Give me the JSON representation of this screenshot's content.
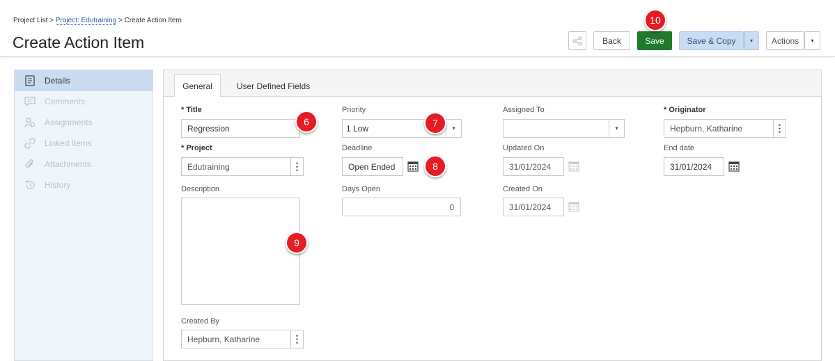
{
  "breadcrumb": {
    "root": "Project List",
    "sep1": ">",
    "project": "Project: Edutraining",
    "sep2": ">",
    "current": "Create Action Item"
  },
  "page_title": "Create Action Item",
  "toolbar": {
    "back_label": "Back",
    "save_label": "Save",
    "save_copy_label": "Save & Copy",
    "actions_label": "Actions",
    "caret": "▾"
  },
  "markers": {
    "m6": "6",
    "m7": "7",
    "m8": "8",
    "m9": "9",
    "m10": "10"
  },
  "sidebar": {
    "items": [
      {
        "label": "Details",
        "icon": "details-icon"
      },
      {
        "label": "Comments",
        "icon": "comment-icon"
      },
      {
        "label": "Assignments",
        "icon": "assignment-icon"
      },
      {
        "label": "Linked Items",
        "icon": "link-icon"
      },
      {
        "label": "Attachments",
        "icon": "paperclip-icon"
      },
      {
        "label": "History",
        "icon": "history-icon"
      }
    ]
  },
  "tabs": {
    "general": "General",
    "udf": "User Defined Fields"
  },
  "form": {
    "title_label": "Title",
    "title_value": "Regression",
    "project_label": "Project",
    "project_value": "Edutraining",
    "description_label": "Description",
    "created_by_label": "Created By",
    "created_by_value": "Hepburn, Katharine",
    "priority_label": "Priority",
    "priority_value": "1 Low",
    "deadline_label": "Deadline",
    "deadline_value": "Open Ended",
    "days_open_label": "Days Open",
    "days_open_value": "0",
    "assigned_to_label": "Assigned To",
    "assigned_to_value": "",
    "updated_on_label": "Updated On",
    "updated_on_value": "31/01/2024",
    "created_on_label": "Created On",
    "created_on_value": "31/01/2024",
    "originator_label": "Originator",
    "originator_value": "Hepburn, Katharine",
    "end_date_label": "End date",
    "end_date_value": "31/01/2024",
    "kebab": "⋮"
  },
  "colors": {
    "save_green": "#1f7a2e",
    "marker_red": "#e51c23",
    "active_blue": "#c9dcf2",
    "link_blue": "#2a5db0"
  }
}
